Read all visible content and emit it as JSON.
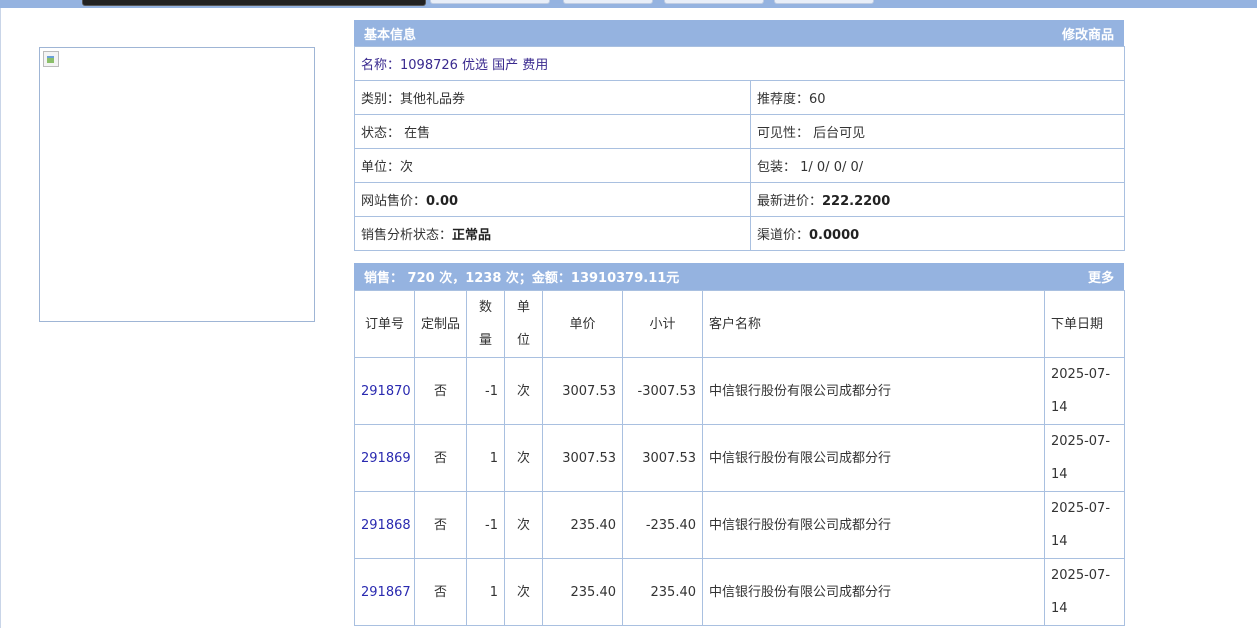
{
  "info": {
    "header_title": "基本信息",
    "header_action": "修改商品",
    "name": "名称：1098726 优选 国产 费用",
    "category": "类别：其他礼品券",
    "recommend": "推荐度：60",
    "status": "状态： 在售",
    "visibility": "可见性： 后台可见",
    "unit": "单位：次",
    "packaging": "包装： 1/ 0/ 0/ 0/",
    "site_price_label": "网站售价：",
    "site_price_value": "0.00",
    "latest_cost_label": "最新进价：",
    "latest_cost_value": "222.2200",
    "analysis_label": "销售分析状态：",
    "analysis_value": "正常品",
    "channel_label": "渠道价：",
    "channel_value": "0.0000"
  },
  "sales": {
    "header_title": "销售： 720 次，1238 次；金额：13910379.11元",
    "header_action": "更多",
    "columns": [
      "订单号",
      "定制品",
      "数量",
      "单位",
      "单价",
      "小计",
      "客户名称",
      "下单日期"
    ],
    "rows": [
      {
        "order": "291870",
        "custom": "否",
        "qty": "-1",
        "unit": "次",
        "price": "3007.53",
        "subtotal": "-3007.53",
        "customer": "中信银行股份有限公司成都分行",
        "date": "2025-07-14"
      },
      {
        "order": "291869",
        "custom": "否",
        "qty": "1",
        "unit": "次",
        "price": "3007.53",
        "subtotal": "3007.53",
        "customer": "中信银行股份有限公司成都分行",
        "date": "2025-07-14"
      },
      {
        "order": "291868",
        "custom": "否",
        "qty": "-1",
        "unit": "次",
        "price": "235.40",
        "subtotal": "-235.40",
        "customer": "中信银行股份有限公司成都分行",
        "date": "2025-07-14"
      },
      {
        "order": "291867",
        "custom": "否",
        "qty": "1",
        "unit": "次",
        "price": "235.40",
        "subtotal": "235.40",
        "customer": "中信银行股份有限公司成都分行",
        "date": "2025-07-14"
      }
    ]
  }
}
